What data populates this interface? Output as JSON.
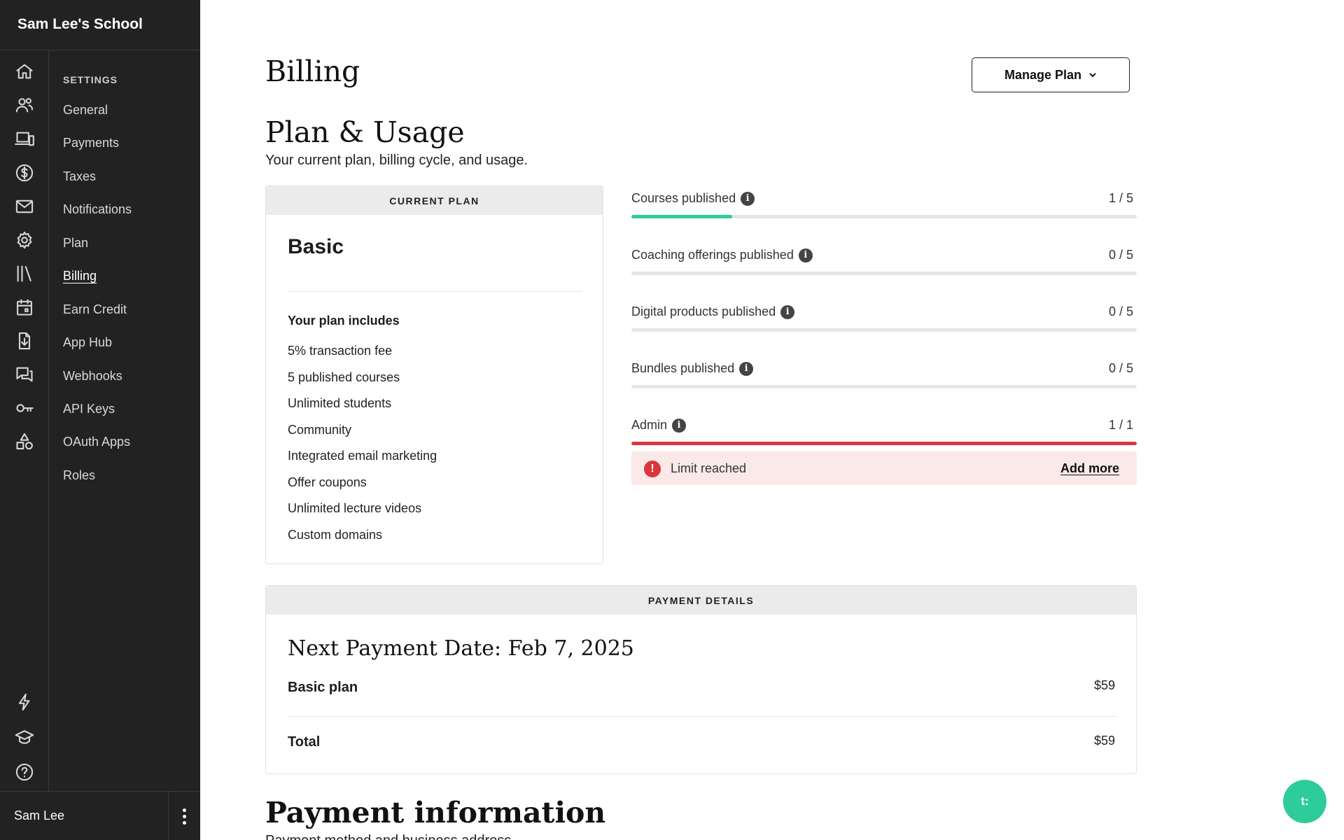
{
  "sidebar": {
    "school_name": "Sam Lee's School",
    "section_heading": "SETTINGS",
    "items": [
      {
        "label": "General"
      },
      {
        "label": "Payments"
      },
      {
        "label": "Taxes"
      },
      {
        "label": "Notifications"
      },
      {
        "label": "Plan"
      },
      {
        "label": "Billing",
        "active": true
      },
      {
        "label": "Earn Credit"
      },
      {
        "label": "App Hub"
      },
      {
        "label": "Webhooks"
      },
      {
        "label": "API Keys"
      },
      {
        "label": "OAuth Apps"
      },
      {
        "label": "Roles"
      }
    ],
    "rail_icons": [
      "home-icon",
      "users-icon",
      "devices-icon",
      "dollar-icon",
      "mail-icon",
      "gear-icon",
      "library-icon",
      "calendar-icon",
      "download-icon",
      "chat-icon",
      "key-icon",
      "shapes-icon",
      "bolt-icon",
      "graduation-cap-icon",
      "help-icon"
    ],
    "user_name": "Sam Lee"
  },
  "header": {
    "title": "Billing",
    "manage_plan_label": "Manage Plan"
  },
  "plan_usage": {
    "title": "Plan & Usage",
    "subtitle": "Your current plan, billing cycle, and usage.",
    "current_plan": {
      "heading": "CURRENT PLAN",
      "name": "Basic",
      "includes_title": "Your plan includes",
      "features": [
        "5% transaction fee",
        "5 published courses",
        "Unlimited students",
        "Community",
        "Integrated email marketing",
        "Offer coupons",
        "Unlimited lecture videos",
        "Custom domains"
      ]
    },
    "usage": [
      {
        "label": "Courses published",
        "count": "1 / 5",
        "used": 1,
        "limit": 5,
        "color": "#2ecc9a"
      },
      {
        "label": "Coaching offerings published",
        "count": "0 / 5",
        "used": 0,
        "limit": 5,
        "color": "#2ecc9a"
      },
      {
        "label": "Digital products published",
        "count": "0 / 5",
        "used": 0,
        "limit": 5,
        "color": "#2ecc9a"
      },
      {
        "label": "Bundles published",
        "count": "0 / 5",
        "used": 0,
        "limit": 5,
        "color": "#2ecc9a"
      },
      {
        "label": "Admin",
        "count": "1 / 1",
        "used": 1,
        "limit": 1,
        "color": "#d9363e"
      }
    ],
    "limit_alert": {
      "text": "Limit reached",
      "action": "Add more"
    }
  },
  "payment_details": {
    "heading": "PAYMENT DETAILS",
    "next_payment": "Next Payment Date: Feb 7, 2025",
    "plan_label": "Basic plan",
    "plan_amount": "$59",
    "total_label": "Total",
    "total_amount": "$59"
  },
  "payment_information": {
    "title": "Payment information",
    "subtitle": "Payment method and business address"
  },
  "chat": {
    "label": "t:"
  }
}
